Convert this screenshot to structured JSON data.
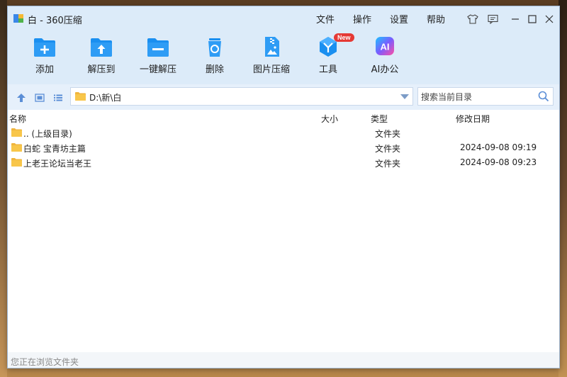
{
  "window": {
    "title": "白 - 360压缩"
  },
  "menu": [
    {
      "label": "文件"
    },
    {
      "label": "操作"
    },
    {
      "label": "设置"
    },
    {
      "label": "帮助"
    }
  ],
  "toolbar": [
    {
      "label": "添加",
      "icon": "add-folder-icon"
    },
    {
      "label": "解压到",
      "icon": "extract-to-icon"
    },
    {
      "label": "一键解压",
      "icon": "one-click-extract-icon"
    },
    {
      "label": "删除",
      "icon": "recycle-bin-icon"
    },
    {
      "label": "图片压缩",
      "icon": "image-compress-icon"
    },
    {
      "label": "工具",
      "icon": "tools-icon",
      "badge": "New"
    },
    {
      "label": "AI办公",
      "icon": "ai-office-icon"
    }
  ],
  "address": {
    "path": "D:\\新\\白"
  },
  "search": {
    "placeholder": "搜索当前目录"
  },
  "columns": {
    "name": "名称",
    "size": "大小",
    "type": "类型",
    "date": "修改日期"
  },
  "rows": [
    {
      "name": ".. (上级目录)",
      "size": "",
      "type": "文件夹",
      "date": ""
    },
    {
      "name": "白蛇 宝青坊主篇",
      "size": "",
      "type": "文件夹",
      "date": "2024-09-08 09:19"
    },
    {
      "name": "上老王论坛当老王",
      "size": "",
      "type": "文件夹",
      "date": "2024-09-08 09:23"
    }
  ],
  "status": {
    "text": "您正在浏览文件夹"
  },
  "colors": {
    "accent": "#1a8ff0",
    "title_bg": "#dcebf9",
    "folder": "#f8c64a",
    "badge": "#e53935"
  }
}
